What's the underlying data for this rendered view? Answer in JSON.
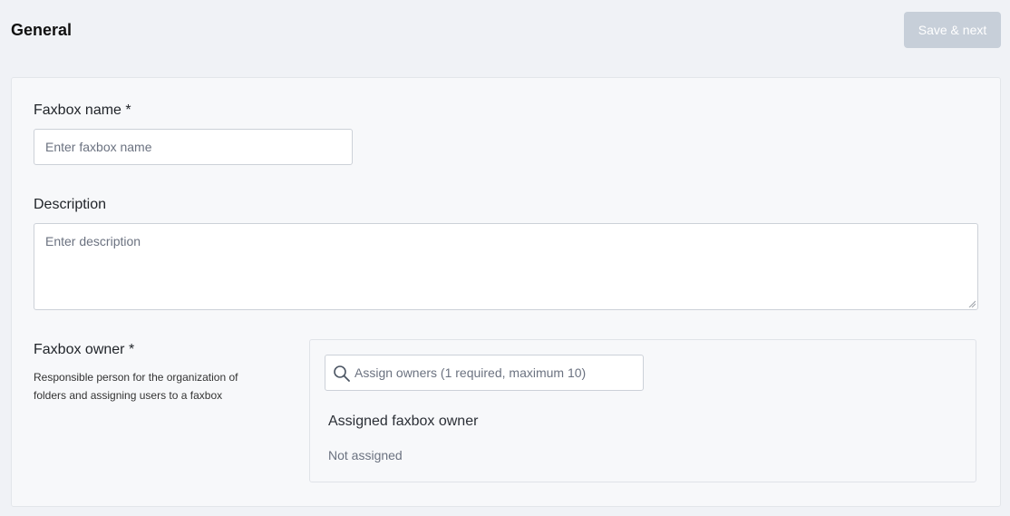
{
  "header": {
    "title": "General",
    "save_next_label": "Save & next"
  },
  "form": {
    "faxbox_name": {
      "label": "Faxbox name *",
      "placeholder": "Enter faxbox name"
    },
    "description": {
      "label": "Description",
      "placeholder": "Enter description"
    },
    "faxbox_owner": {
      "label": "Faxbox owner *",
      "help_line1": "Responsible person for the organization of",
      "help_line2": "folders and assigning users to a faxbox",
      "search_placeholder": "Assign owners (1 required, maximum 10)",
      "assigned_title": "Assigned faxbox owner",
      "assigned_value": "Not assigned"
    }
  },
  "icons": {
    "search": "search-icon",
    "resize": "resize-grip-icon"
  },
  "colors": {
    "page_background": "#f0f2f6",
    "card_background": "#f7f8fa",
    "disabled_button": "#c7cfd9",
    "border": "#ccd1d8",
    "placeholder_text": "#6b7280"
  }
}
